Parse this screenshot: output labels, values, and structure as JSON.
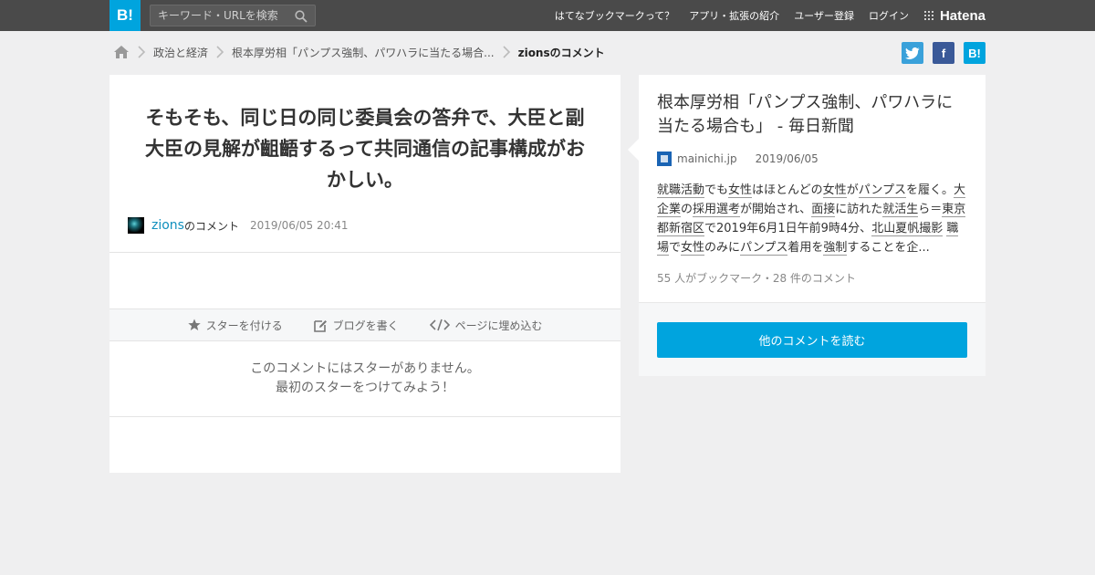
{
  "header": {
    "logo": "B!",
    "search_placeholder": "キーワード・URLを検索",
    "nav": [
      "はてなブックマークって？",
      "アプリ・拡張の紹介",
      "ユーザー登録",
      "ログイン"
    ],
    "brand": "Hatena"
  },
  "breadcrumb": {
    "items": [
      "政治と経済",
      "根本厚労相「パンプス強制、パワハラに当たる場合...",
      "zionsのコメント"
    ]
  },
  "share": {
    "twitter": "t",
    "facebook": "f",
    "hatena": "B!"
  },
  "comment": {
    "text": "そもそも、同じ日の同じ委員会の答弁で、大臣と副大臣の見解が齟齬するって共同通信の記事構成がおかしい。",
    "user": "zions",
    "user_suffix": "のコメント",
    "date": "2019/06/05 20:41"
  },
  "actions": {
    "star": "スターを付ける",
    "blog": "ブログを書く",
    "embed": "ページに埋め込む"
  },
  "stars_message": {
    "line1": "このコメントにはスターがありません。",
    "line2": "最初のスターをつけてみよう！"
  },
  "entry": {
    "title": "根本厚労相「パンプス強制、パワハラに当たる場合も」 - 毎日新聞",
    "site": "mainichi.jp",
    "date": "2019/06/05",
    "excerpt": [
      {
        "t": "就職活動",
        "k": true
      },
      {
        "t": "でも",
        "k": false
      },
      {
        "t": "女性",
        "k": true
      },
      {
        "t": "はほとんどの",
        "k": false
      },
      {
        "t": "女性",
        "k": true
      },
      {
        "t": "が",
        "k": false
      },
      {
        "t": "パンプス",
        "k": true
      },
      {
        "t": "を履く。",
        "k": false
      },
      {
        "t": "大企業",
        "k": true
      },
      {
        "t": "の",
        "k": false
      },
      {
        "t": "採用選考",
        "k": true
      },
      {
        "t": "が開始され、",
        "k": false
      },
      {
        "t": "面接",
        "k": true
      },
      {
        "t": "に訪れた",
        "k": false
      },
      {
        "t": "就活生",
        "k": true
      },
      {
        "t": "ら＝",
        "k": false
      },
      {
        "t": "東京都新宿区",
        "k": true
      },
      {
        "t": "で2019年6月1日午前9時4分、",
        "k": false
      },
      {
        "t": "北山夏帆",
        "k": true
      },
      {
        "t": "撮影",
        "k": true
      },
      {
        "t": " ",
        "k": false
      },
      {
        "t": "職場",
        "k": true
      },
      {
        "t": "で",
        "k": false
      },
      {
        "t": "女性",
        "k": true
      },
      {
        "t": "のみに",
        "k": false
      },
      {
        "t": "パンプス",
        "k": true
      },
      {
        "t": "着用を",
        "k": false
      },
      {
        "t": "強制",
        "k": true
      },
      {
        "t": "することを企...",
        "k": false
      }
    ],
    "stats": "55 人がブックマーク・28 件のコメント"
  },
  "read_more": "他のコメントを読む"
}
